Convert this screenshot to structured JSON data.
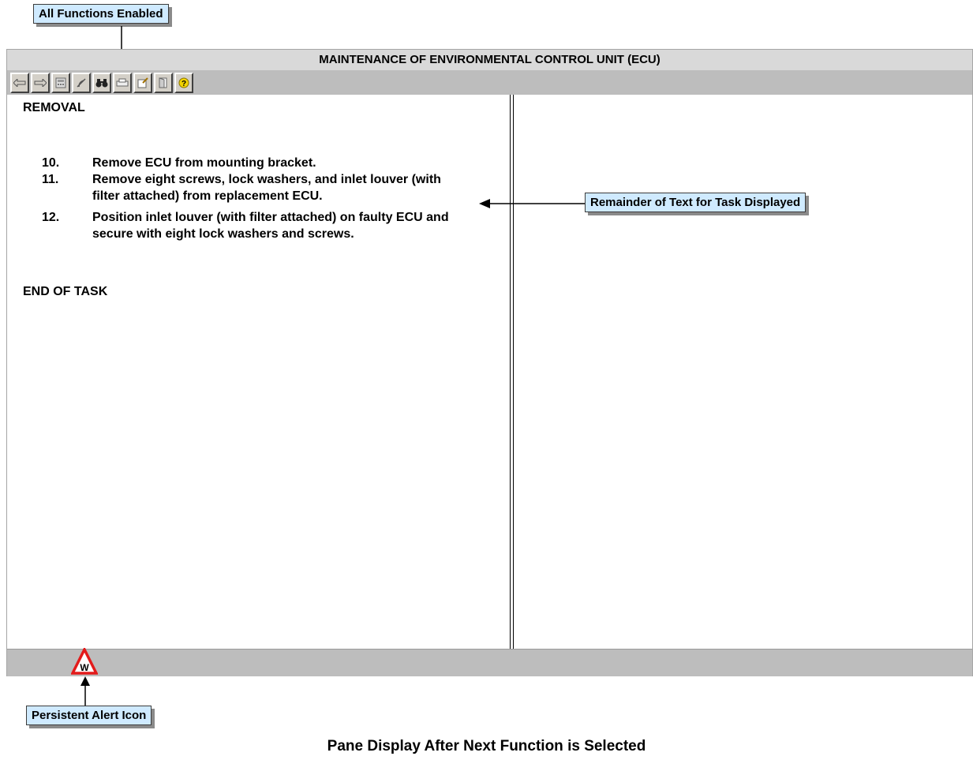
{
  "callouts": {
    "functions": "All Functions Enabled",
    "remainder": "Remainder of Text for Task Displayed",
    "alert": "Persistent Alert Icon"
  },
  "window": {
    "title": "MAINTENANCE OF ENVIRONMENTAL CONTROL UNIT (ECU)"
  },
  "toolbar": {
    "buttons": [
      {
        "icon": "back-arrow-icon"
      },
      {
        "icon": "forward-arrow-icon"
      },
      {
        "icon": "calculator-icon"
      },
      {
        "icon": "signal-icon"
      },
      {
        "icon": "binoculars-icon"
      },
      {
        "icon": "print-icon"
      },
      {
        "icon": "notes-icon"
      },
      {
        "icon": "exit-door-icon"
      },
      {
        "icon": "help-icon"
      }
    ]
  },
  "content": {
    "heading": "REMOVAL",
    "steps": [
      {
        "number": "10.",
        "text": "Remove ECU from mounting bracket."
      },
      {
        "number": "11.",
        "text": "Remove eight screws, lock washers, and inlet louver (with filter attached) from replacement ECU."
      },
      {
        "number": "12.",
        "text": "Position inlet louver (with filter attached) on faulty ECU and secure with eight lock washers and screws."
      }
    ],
    "end": "END OF TASK"
  },
  "status": {
    "alert_letter": "W",
    "alert_color": "#e31b1b"
  },
  "caption": "Pane Display After Next Function is Selected"
}
